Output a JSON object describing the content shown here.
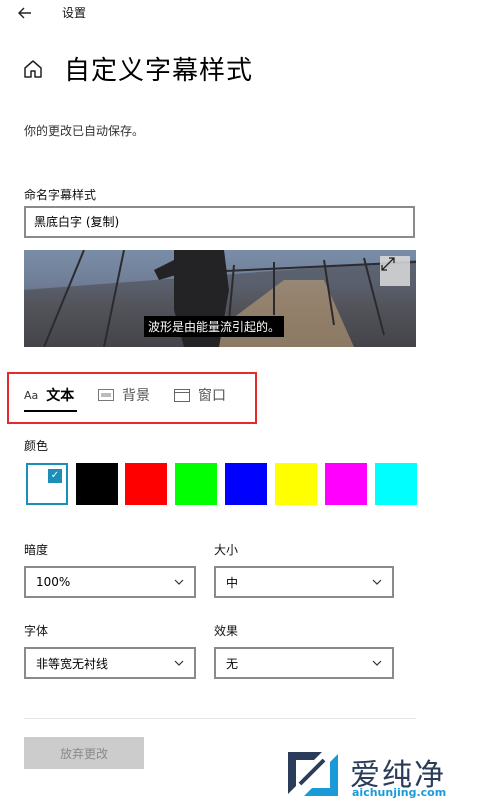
{
  "window": {
    "title": "设置"
  },
  "page": {
    "title": "自定义字幕样式",
    "autosave_note": "你的更改已自动保存。"
  },
  "name_field": {
    "label": "命名字幕样式",
    "value": "黑底白字 (复制)"
  },
  "preview": {
    "caption": "波形是由能量流引起的。"
  },
  "tabs": [
    {
      "label": "文本",
      "icon_text": "Aa",
      "icon": "text-icon",
      "selected": true
    },
    {
      "label": "背景",
      "icon": "background-icon",
      "selected": false
    },
    {
      "label": "窗口",
      "icon": "window-icon",
      "selected": false
    }
  ],
  "colors": {
    "label": "颜色",
    "swatches": [
      "#ffffff",
      "#000000",
      "#ff0000",
      "#00ff00",
      "#0000ff",
      "#ffff00",
      "#ff00ff",
      "#00ffff"
    ],
    "selected_index": 0,
    "accent": "#1b8fb8"
  },
  "settings": {
    "opacity": {
      "label": "暗度",
      "value": "100%"
    },
    "size": {
      "label": "大小",
      "value": "中"
    },
    "font": {
      "label": "字体",
      "value": "非等宽无衬线"
    },
    "effect": {
      "label": "效果",
      "value": "无"
    }
  },
  "discard_button": {
    "label": "放弃更改"
  },
  "watermark": {
    "brand": "爱纯净",
    "url": "aichunjing.com"
  },
  "highlight_color": "#e32b2b"
}
